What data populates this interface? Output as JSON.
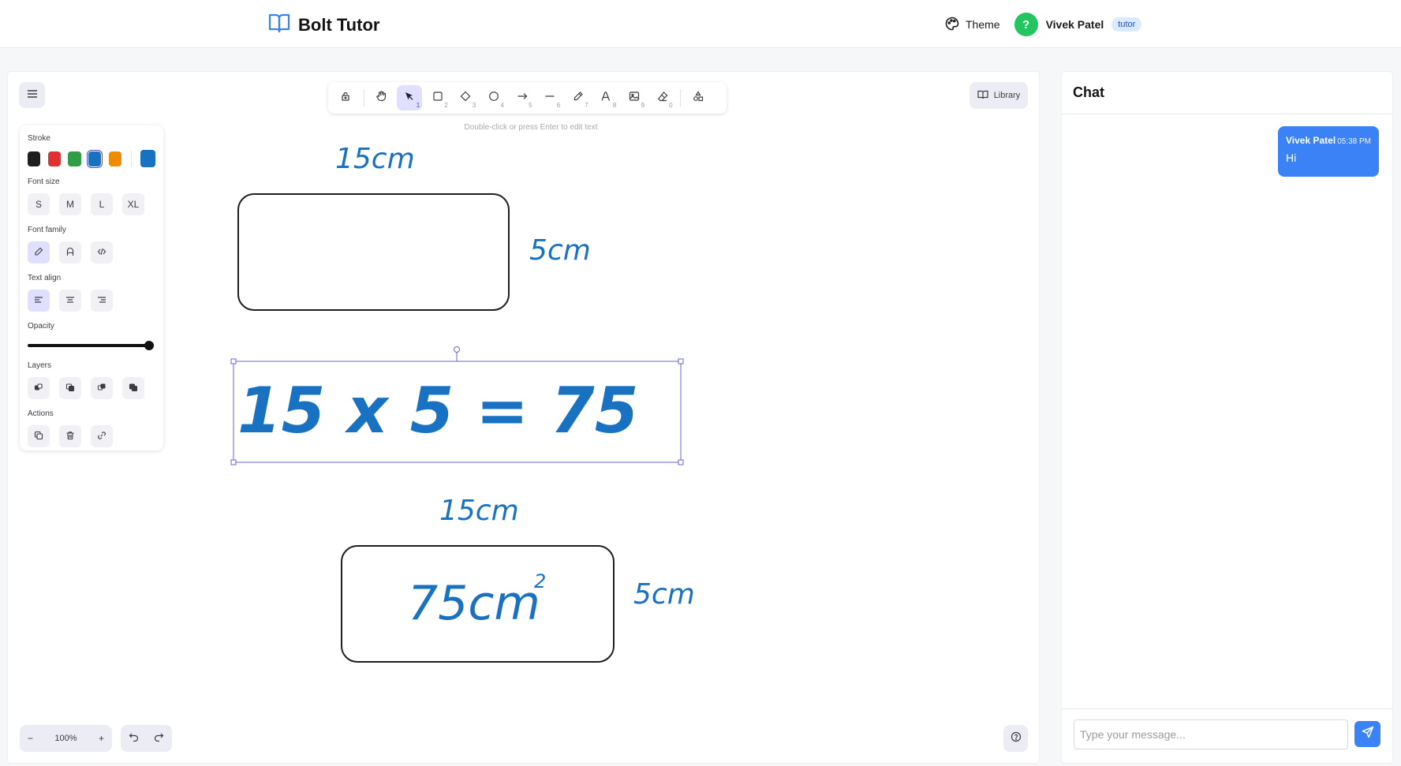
{
  "header": {
    "brand_icon": "book-open-icon",
    "title": "Bolt Tutor",
    "theme_icon": "palette-icon",
    "theme_label": "Theme",
    "avatar_initial": "?",
    "avatar_color": "#22c55e",
    "user_name": "Vivek Patel",
    "role_badge": "tutor"
  },
  "toolbar": {
    "tools": [
      {
        "name": "lock",
        "icon": "lock-icon",
        "key": ""
      },
      {
        "name": "hand",
        "icon": "hand-icon",
        "key": ""
      },
      {
        "name": "selection",
        "icon": "pointer-icon",
        "key": "1",
        "active": true
      },
      {
        "name": "rectangle",
        "icon": "square-icon",
        "key": "2"
      },
      {
        "name": "diamond",
        "icon": "diamond-icon",
        "key": "3"
      },
      {
        "name": "ellipse",
        "icon": "circle-icon",
        "key": "4"
      },
      {
        "name": "arrow",
        "icon": "arrow-right-icon",
        "key": "5"
      },
      {
        "name": "line",
        "icon": "line-icon",
        "key": "6"
      },
      {
        "name": "draw",
        "icon": "pencil-icon",
        "key": "7"
      },
      {
        "name": "text",
        "icon": "text-icon",
        "key": "8"
      },
      {
        "name": "image",
        "icon": "image-icon",
        "key": "9"
      },
      {
        "name": "eraser",
        "icon": "eraser-icon",
        "key": "0"
      },
      {
        "name": "extra-tools",
        "icon": "shapes-icon",
        "key": ""
      }
    ],
    "hint": "Double-click or press Enter to edit text",
    "library_label": "Library"
  },
  "properties": {
    "stroke_label": "Stroke",
    "stroke_colors": [
      "#1e1e1e",
      "#e03131",
      "#2f9e44",
      "#1971c2",
      "#f08c00"
    ],
    "stroke_active": "#1971c2",
    "font_size_label": "Font size",
    "font_sizes": [
      "S",
      "M",
      "L",
      "XL"
    ],
    "font_family_label": "Font family",
    "text_align_label": "Text align",
    "opacity_label": "Opacity",
    "opacity_value": 100,
    "layers_label": "Layers",
    "actions_label": "Actions"
  },
  "canvas": {
    "label_top_width": "15cm",
    "label_top_height": "5cm",
    "equation": "15 x 5 = 75",
    "label_bottom_width": "15cm",
    "label_bottom_height": "5cm",
    "area_value": "75cm",
    "area_exponent": "2",
    "ink_color": "#1971c2",
    "shape_stroke": "#1e1e1e",
    "selection_color": "#6965db"
  },
  "footer": {
    "zoom_minus": "−",
    "zoom_level": "100%",
    "zoom_plus": "+"
  },
  "chat": {
    "title": "Chat",
    "messages": [
      {
        "author": "Vivek Patel",
        "time": "05:38 PM",
        "text": "Hi"
      }
    ],
    "input_placeholder": "Type your message...",
    "accent": "#3b82f6"
  }
}
